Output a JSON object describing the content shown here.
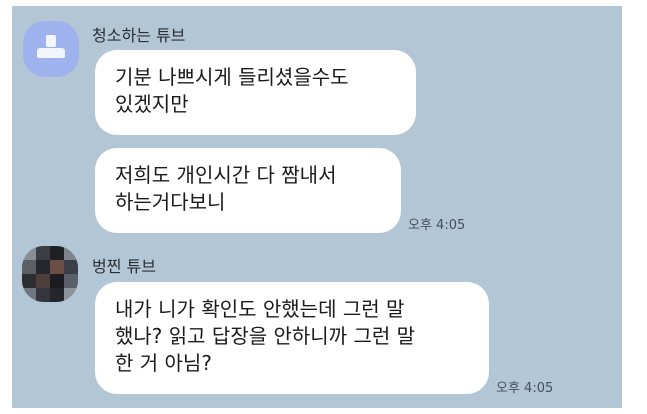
{
  "messages": [
    {
      "sender": "청소하는 튜브",
      "avatar": "default-profile-icon",
      "bubbles": [
        {
          "text": "기분 나쁘시게 들리셨을수도\n있겠지만"
        },
        {
          "text": "저희도 개인시간 다 짬내서\n하는거다보니",
          "time": "오후 4:05"
        }
      ]
    },
    {
      "sender": "벙찐 튜브",
      "avatar": "pixelated-profile-photo",
      "bubbles": [
        {
          "text": "내가 니가 확인도 안했는데 그런 말\n했나? 읽고 답장을 안하니까 그런 말\n한 거 아님?",
          "time": "오후 4:05"
        }
      ]
    }
  ],
  "colors": {
    "chat_background": "#b3c6d6",
    "bubble": "#ffffff",
    "default_avatar": "#9eb3ee"
  }
}
